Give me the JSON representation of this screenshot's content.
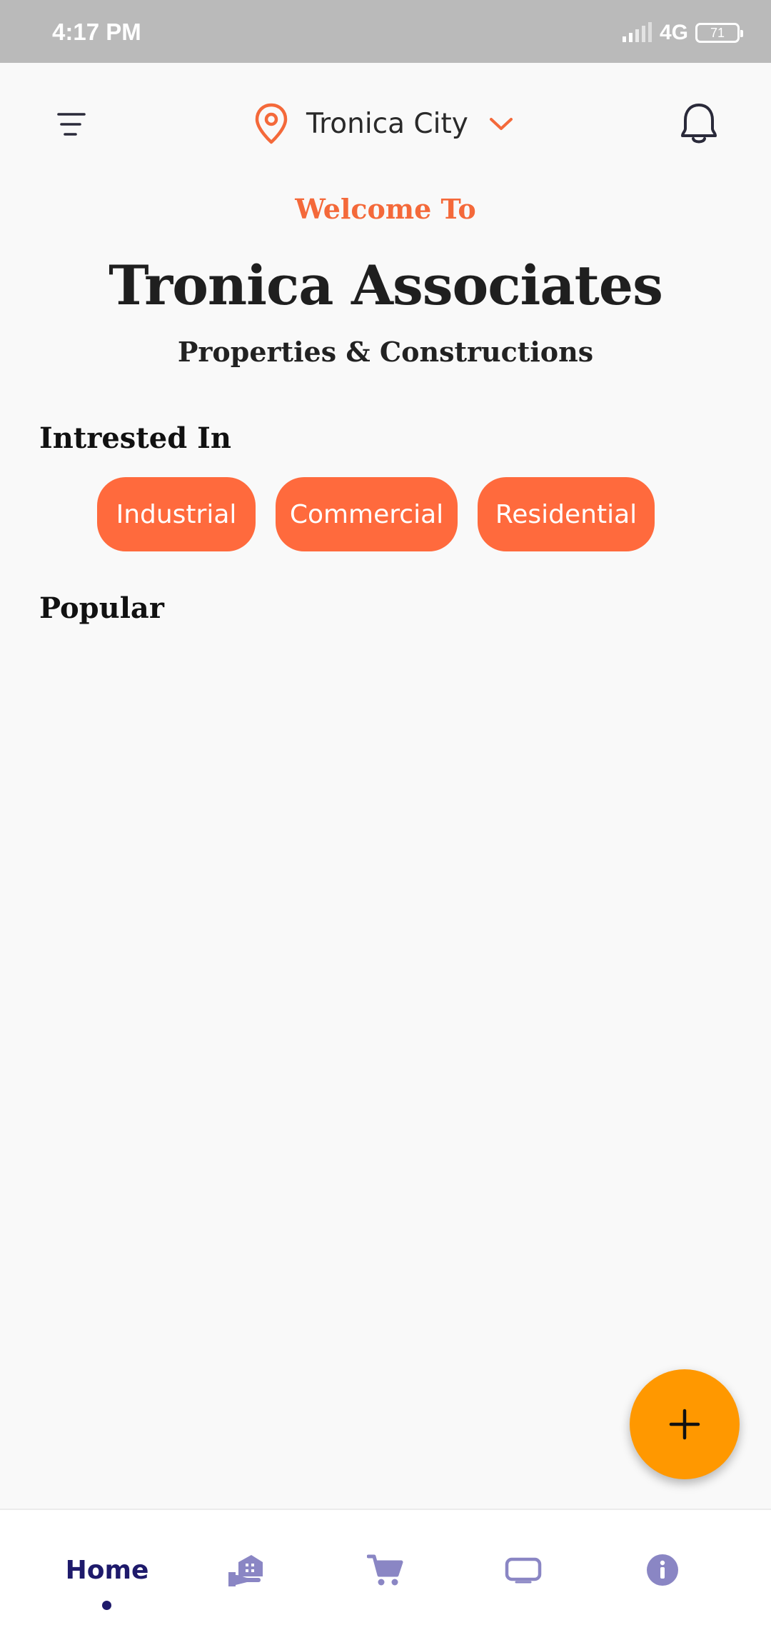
{
  "status_bar": {
    "time": "4:17 PM",
    "network": "4G",
    "battery": "71"
  },
  "header": {
    "menu_icon": "filter-menu-icon",
    "location_icon": "map-pin-icon",
    "location": "Tronica City",
    "dropdown_icon": "chevron-down-icon",
    "notification_icon": "bell-icon"
  },
  "hero": {
    "welcome": "Welcome To",
    "title": "Tronica Associates",
    "subtitle": "Properties & Constructions"
  },
  "interested": {
    "heading": "Intrested In",
    "chips": [
      "Industrial",
      "Commercial",
      "Residential"
    ]
  },
  "popular": {
    "heading": "Popular"
  },
  "fab": {
    "icon": "plus-icon"
  },
  "bottom_nav": {
    "items": [
      {
        "label": "Home",
        "icon": "home",
        "active": true
      },
      {
        "label": "",
        "icon": "property-hand-icon"
      },
      {
        "label": "",
        "icon": "cart-icon"
      },
      {
        "label": "",
        "icon": "screen-icon"
      },
      {
        "label": "",
        "icon": "info-icon"
      }
    ]
  },
  "colors": {
    "accent": "#ff6a3d",
    "welcome_text": "#f4693a",
    "fab": "#ff9800",
    "nav_active": "#1e1a6b",
    "nav_inactive": "#8a86c4",
    "status_bar": "#bababa"
  }
}
